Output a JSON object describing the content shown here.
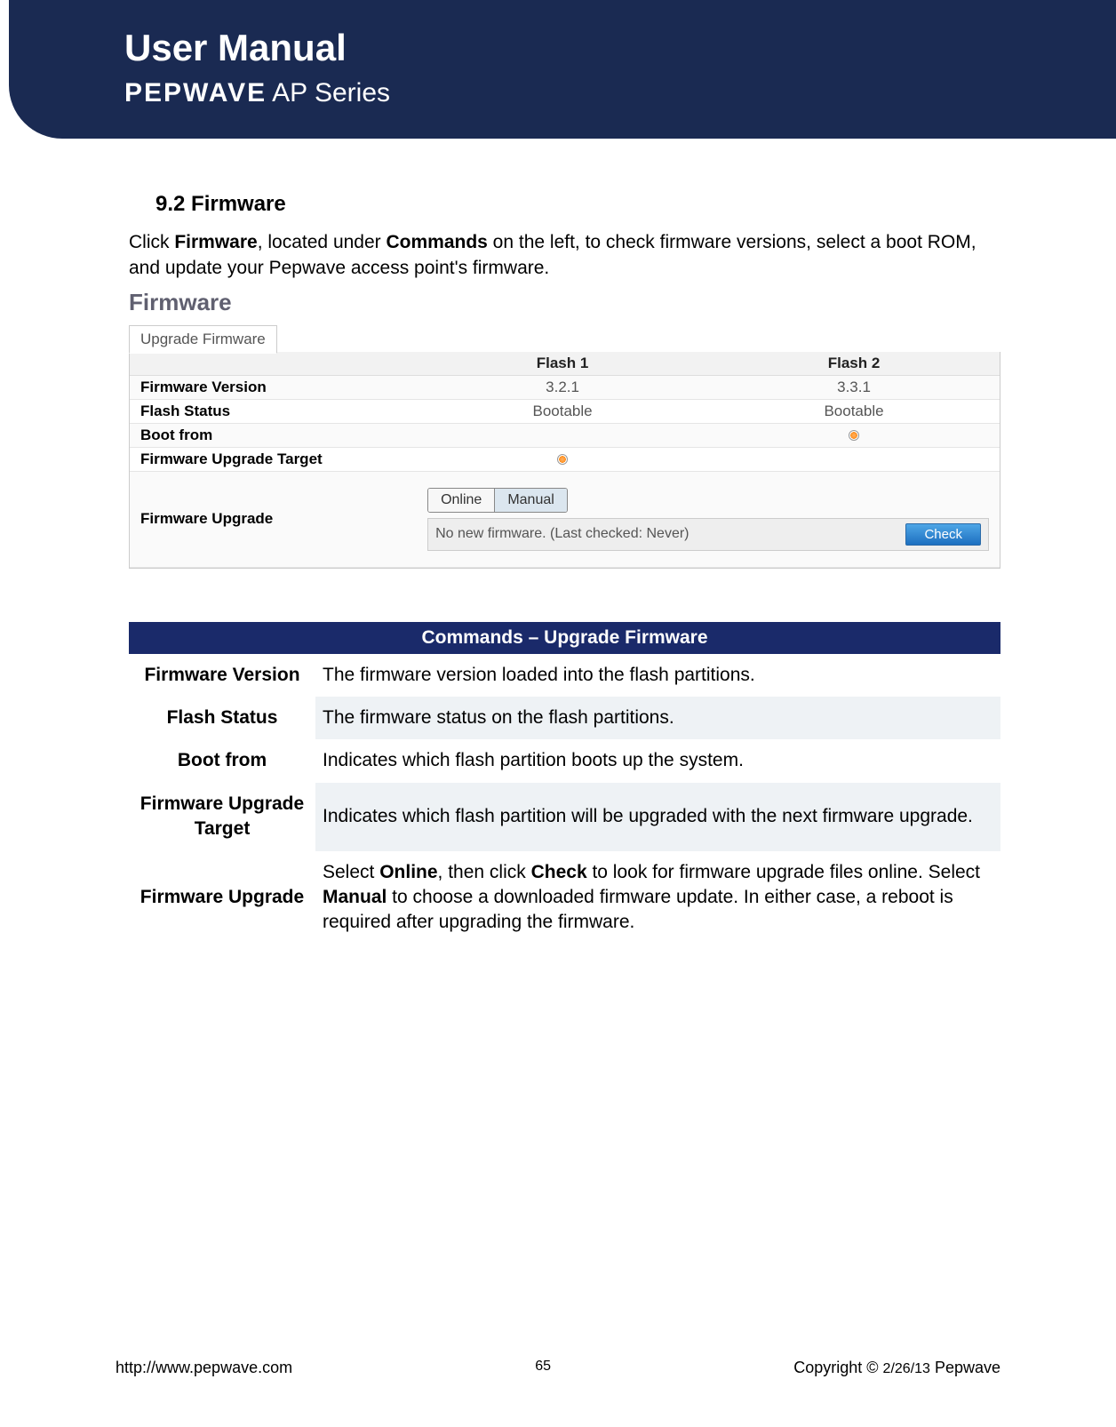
{
  "header": {
    "title": "User Manual",
    "brand": "PEPWAVE",
    "series": "AP Series"
  },
  "section": {
    "heading": "9.2 Firmware",
    "intro_pre": "Click ",
    "intro_b1": "Firmware",
    "intro_mid1": ", located under ",
    "intro_b2": "Commands",
    "intro_post": " on the left, to check firmware versions, select a boot ROM, and update your Pepwave access point's firmware."
  },
  "panel": {
    "title": "Firmware",
    "tab": "Upgrade Firmware",
    "cols": [
      "",
      "Flash 1",
      "Flash 2"
    ],
    "rows": {
      "fw_version": {
        "label": "Firmware Version",
        "c1": "3.2.1",
        "c2": "3.3.1"
      },
      "flash_status": {
        "label": "Flash Status",
        "c1": "Bootable",
        "c2": "Bootable"
      },
      "boot_from": {
        "label": "Boot from"
      },
      "upgrade_target": {
        "label": "Firmware Upgrade Target"
      },
      "upgrade": {
        "label": "Firmware Upgrade"
      }
    },
    "seg": {
      "online": "Online",
      "manual": "Manual"
    },
    "status": "No new firmware. (Last checked: Never)",
    "check": "Check"
  },
  "desc": {
    "header": "Commands – Upgrade Firmware",
    "rows": [
      {
        "label": "Firmware Version",
        "text": "The firmware version loaded into the flash partitions."
      },
      {
        "label": "Flash Status",
        "text": "The firmware status on the flash partitions."
      },
      {
        "label": "Boot from",
        "text": "Indicates which flash partition boots up the system."
      },
      {
        "label": "Firmware Upgrade Target",
        "text": "Indicates which flash partition will be upgraded with the next firmware upgrade."
      }
    ],
    "upgrade_row": {
      "label": "Firmware Upgrade",
      "p1": "Select ",
      "b1": "Online",
      "p2": ", then click ",
      "b2": "Check",
      "p3": " to look for firmware upgrade files online. Select ",
      "b3": "Manual",
      "p4": " to choose a downloaded firmware update. In either case, a reboot is required after upgrading the firmware."
    }
  },
  "footer": {
    "url": "http://www.pepwave.com",
    "page": "65",
    "copyright_pre": "Copyright © ",
    "date": "2/26/13",
    "copyright_post": " Pepwave"
  }
}
